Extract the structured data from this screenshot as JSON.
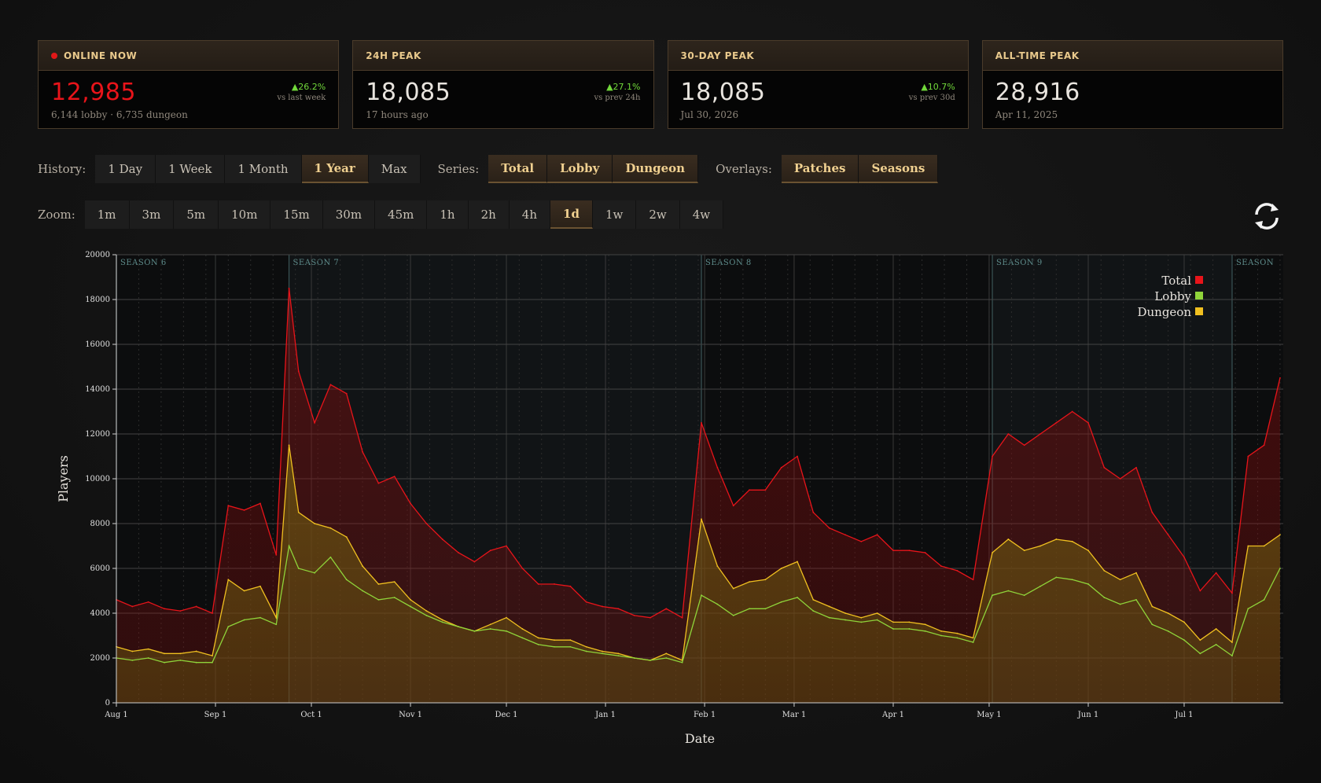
{
  "stats": [
    {
      "title": "ONLINE NOW",
      "value": "12,985",
      "sub": "6,144 lobby · 6,735 dungeon",
      "delta": "▲26.2%",
      "vs": "vs last week",
      "live": true
    },
    {
      "title": "24H PEAK",
      "value": "18,085",
      "sub": "17 hours ago",
      "delta": "▲27.1%",
      "vs": "vs prev 24h"
    },
    {
      "title": "30-DAY PEAK",
      "value": "18,085",
      "sub": "Jul 30, 2026",
      "delta": "▲10.7%",
      "vs": "vs prev 30d"
    },
    {
      "title": "ALL-TIME PEAK",
      "value": "28,916",
      "sub": "Apr 11, 2025",
      "delta": "",
      "vs": ""
    }
  ],
  "controls": {
    "history_label": "History:",
    "history": [
      "1 Day",
      "1 Week",
      "1 Month",
      "1 Year",
      "Max"
    ],
    "history_active": "1 Year",
    "series_label": "Series:",
    "series": [
      "Total",
      "Lobby",
      "Dungeon"
    ],
    "overlays_label": "Overlays:",
    "overlays": [
      "Patches",
      "Seasons"
    ],
    "zoom_label": "Zoom:",
    "zoom": [
      "1m",
      "3m",
      "5m",
      "10m",
      "15m",
      "30m",
      "45m",
      "1h",
      "2h",
      "4h",
      "1d",
      "1w",
      "2w",
      "4w"
    ],
    "zoom_active": "1d"
  },
  "colors": {
    "total": "#e8141a",
    "lobby": "#8fd43a",
    "dungeon": "#f0c020",
    "accent": "#f0d090"
  },
  "icons": {
    "refresh": "refresh-icon"
  },
  "chart_data": {
    "type": "line",
    "xlabel": "Date",
    "ylabel": "Players",
    "ylim": [
      0,
      20000
    ],
    "yticks": [
      0,
      2000,
      4000,
      6000,
      8000,
      10000,
      12000,
      14000,
      16000,
      18000,
      20000
    ],
    "xticks": [
      "Aug 1",
      "Sep 1",
      "Oct 1",
      "Nov 1",
      "Dec 1",
      "Jan 1",
      "Feb 1",
      "Mar 1",
      "Apr 1",
      "May 1",
      "Jun 1",
      "Jul 1"
    ],
    "x_start": "Aug 1",
    "seasons": [
      {
        "label": "SEASON 6",
        "start": "Aug 1"
      },
      {
        "label": "SEASON 7",
        "start": "Sep 24"
      },
      {
        "label": "SEASON 8",
        "start": "Jan 31"
      },
      {
        "label": "SEASON 9",
        "start": "May 2"
      },
      {
        "label": "SEASON",
        "start": "Jul 16"
      }
    ],
    "legend": [
      "Total",
      "Lobby",
      "Dungeon"
    ],
    "legend_position": "top-right",
    "grid": true,
    "series": [
      {
        "name": "Total",
        "x": [
          "Aug 1",
          "Aug 6",
          "Aug 11",
          "Aug 16",
          "Aug 21",
          "Aug 26",
          "Aug 31",
          "Sep 5",
          "Sep 10",
          "Sep 15",
          "Sep 20",
          "Sep 24",
          "Sep 27",
          "Oct 2",
          "Oct 7",
          "Oct 12",
          "Oct 17",
          "Oct 22",
          "Oct 27",
          "Nov 1",
          "Nov 6",
          "Nov 11",
          "Nov 16",
          "Nov 21",
          "Nov 26",
          "Dec 1",
          "Dec 6",
          "Dec 11",
          "Dec 16",
          "Dec 21",
          "Dec 26",
          "Dec 31",
          "Jan 5",
          "Jan 10",
          "Jan 15",
          "Jan 20",
          "Jan 25",
          "Jan 31",
          "Feb 5",
          "Feb 10",
          "Feb 15",
          "Feb 20",
          "Feb 25",
          "Mar 2",
          "Mar 7",
          "Mar 12",
          "Mar 17",
          "Mar 22",
          "Mar 27",
          "Apr 1",
          "Apr 6",
          "Apr 11",
          "Apr 16",
          "Apr 21",
          "Apr 26",
          "May 2",
          "May 7",
          "May 12",
          "May 17",
          "May 22",
          "May 27",
          "Jun 1",
          "Jun 6",
          "Jun 11",
          "Jun 16",
          "Jun 21",
          "Jun 26",
          "Jul 1",
          "Jul 6",
          "Jul 11",
          "Jul 16",
          "Jul 21",
          "Jul 26",
          "Jul 31"
        ],
        "values": [
          4600,
          4300,
          4500,
          4200,
          4100,
          4300,
          4000,
          8800,
          8600,
          8900,
          6600,
          18500,
          14800,
          12500,
          14200,
          13800,
          11200,
          9800,
          10100,
          8900,
          8000,
          7300,
          6700,
          6300,
          6800,
          7000,
          6000,
          5300,
          5300,
          5200,
          4500,
          4300,
          4200,
          3900,
          3800,
          4200,
          3800,
          12500,
          10500,
          8800,
          9500,
          9500,
          10500,
          11000,
          8500,
          7800,
          7500,
          7200,
          7500,
          6800,
          6800,
          6700,
          6100,
          5900,
          5500,
          11000,
          12000,
          11500,
          12000,
          12500,
          13000,
          12500,
          10500,
          10000,
          10500,
          8500,
          7500,
          6500,
          5000,
          5800,
          4900,
          11000,
          11500,
          14500
        ]
      },
      {
        "name": "Lobby",
        "x": [
          "Aug 1",
          "Aug 6",
          "Aug 11",
          "Aug 16",
          "Aug 21",
          "Aug 26",
          "Aug 31",
          "Sep 5",
          "Sep 10",
          "Sep 15",
          "Sep 20",
          "Sep 24",
          "Sep 27",
          "Oct 2",
          "Oct 7",
          "Oct 12",
          "Oct 17",
          "Oct 22",
          "Oct 27",
          "Nov 1",
          "Nov 6",
          "Nov 11",
          "Nov 16",
          "Nov 21",
          "Nov 26",
          "Dec 1",
          "Dec 6",
          "Dec 11",
          "Dec 16",
          "Dec 21",
          "Dec 26",
          "Dec 31",
          "Jan 5",
          "Jan 10",
          "Jan 15",
          "Jan 20",
          "Jan 25",
          "Jan 31",
          "Feb 5",
          "Feb 10",
          "Feb 15",
          "Feb 20",
          "Feb 25",
          "Mar 2",
          "Mar 7",
          "Mar 12",
          "Mar 17",
          "Mar 22",
          "Mar 27",
          "Apr 1",
          "Apr 6",
          "Apr 11",
          "Apr 16",
          "Apr 21",
          "Apr 26",
          "May 2",
          "May 7",
          "May 12",
          "May 17",
          "May 22",
          "May 27",
          "Jun 1",
          "Jun 6",
          "Jun 11",
          "Jun 16",
          "Jun 21",
          "Jun 26",
          "Jul 1",
          "Jul 6",
          "Jul 11",
          "Jul 16",
          "Jul 21",
          "Jul 26",
          "Jul 31"
        ],
        "values": [
          2000,
          1900,
          2000,
          1800,
          1900,
          1800,
          1800,
          3400,
          3700,
          3800,
          3500,
          7000,
          6000,
          5800,
          6500,
          5500,
          5000,
          4600,
          4700,
          4300,
          3900,
          3600,
          3400,
          3200,
          3300,
          3200,
          2900,
          2600,
          2500,
          2500,
          2300,
          2200,
          2100,
          2000,
          1900,
          2000,
          1800,
          4800,
          4400,
          3900,
          4200,
          4200,
          4500,
          4700,
          4100,
          3800,
          3700,
          3600,
          3700,
          3300,
          3300,
          3200,
          3000,
          2900,
          2700,
          4800,
          5000,
          4800,
          5200,
          5600,
          5500,
          5300,
          4700,
          4400,
          4600,
          3500,
          3200,
          2800,
          2200,
          2600,
          2100,
          4200,
          4600,
          6000
        ]
      },
      {
        "name": "Dungeon",
        "x": [
          "Aug 1",
          "Aug 6",
          "Aug 11",
          "Aug 16",
          "Aug 21",
          "Aug 26",
          "Aug 31",
          "Sep 5",
          "Sep 10",
          "Sep 15",
          "Sep 20",
          "Sep 24",
          "Sep 27",
          "Oct 2",
          "Oct 7",
          "Oct 12",
          "Oct 17",
          "Oct 22",
          "Oct 27",
          "Nov 1",
          "Nov 6",
          "Nov 11",
          "Nov 16",
          "Nov 21",
          "Nov 26",
          "Dec 1",
          "Dec 6",
          "Dec 11",
          "Dec 16",
          "Dec 21",
          "Dec 26",
          "Dec 31",
          "Jan 5",
          "Jan 10",
          "Jan 15",
          "Jan 20",
          "Jan 25",
          "Jan 31",
          "Feb 5",
          "Feb 10",
          "Feb 15",
          "Feb 20",
          "Feb 25",
          "Mar 2",
          "Mar 7",
          "Mar 12",
          "Mar 17",
          "Mar 22",
          "Mar 27",
          "Apr 1",
          "Apr 6",
          "Apr 11",
          "Apr 16",
          "Apr 21",
          "Apr 26",
          "May 2",
          "May 7",
          "May 12",
          "May 17",
          "May 22",
          "May 27",
          "Jun 1",
          "Jun 6",
          "Jun 11",
          "Jun 16",
          "Jun 21",
          "Jun 26",
          "Jul 1",
          "Jul 6",
          "Jul 11",
          "Jul 16",
          "Jul 21",
          "Jul 26",
          "Jul 31"
        ],
        "values": [
          2500,
          2300,
          2400,
          2200,
          2200,
          2300,
          2100,
          5500,
          5000,
          5200,
          3800,
          11500,
          8500,
          8000,
          7800,
          7400,
          6100,
          5300,
          5400,
          4600,
          4100,
          3700,
          3400,
          3200,
          3500,
          3800,
          3300,
          2900,
          2800,
          2800,
          2500,
          2300,
          2200,
          2000,
          1900,
          2200,
          1900,
          8200,
          6100,
          5100,
          5400,
          5500,
          6000,
          6300,
          4600,
          4300,
          4000,
          3800,
          4000,
          3600,
          3600,
          3500,
          3200,
          3100,
          2900,
          6700,
          7300,
          6800,
          7000,
          7300,
          7200,
          6800,
          5900,
          5500,
          5800,
          4300,
          4000,
          3600,
          2800,
          3300,
          2700,
          7000,
          7000,
          7500
        ]
      }
    ]
  }
}
